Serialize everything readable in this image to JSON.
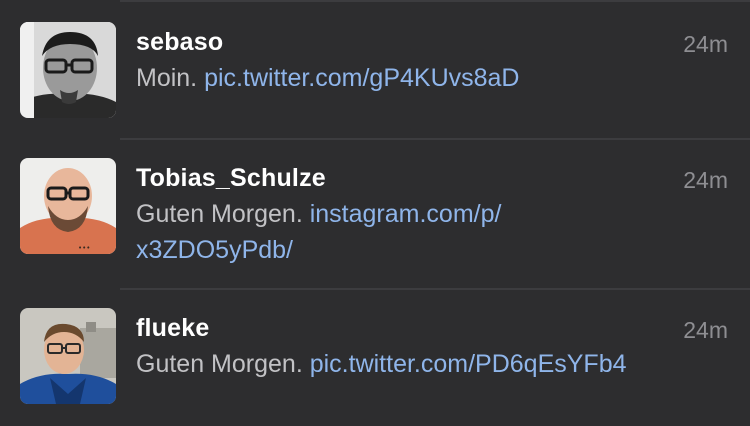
{
  "tweets": [
    {
      "username": "sebaso",
      "time": "24m",
      "text": "Moin.",
      "link": "pic.twitter.com/gP4KUvs8aD",
      "avatar": "avatar-photo-sebaso"
    },
    {
      "username": "Tobias_Schulze",
      "time": "24m",
      "text": "Guten Morgen.",
      "link": "instagram.com/p/\nx3ZDO5yPdb/",
      "avatar": "avatar-photo-tobias-schulze"
    },
    {
      "username": "flueke",
      "time": "24m",
      "text": "Guten Morgen.",
      "link": "pic.twitter.com/PD6qEsYFb4",
      "avatar": "avatar-photo-flueke"
    }
  ],
  "colors": {
    "background": "#2d2d2f",
    "divider": "#3c3c3f",
    "username": "#ffffff",
    "body_text": "#c2c2c5",
    "link": "#8fb5ea",
    "timestamp": "#8e8e92"
  }
}
